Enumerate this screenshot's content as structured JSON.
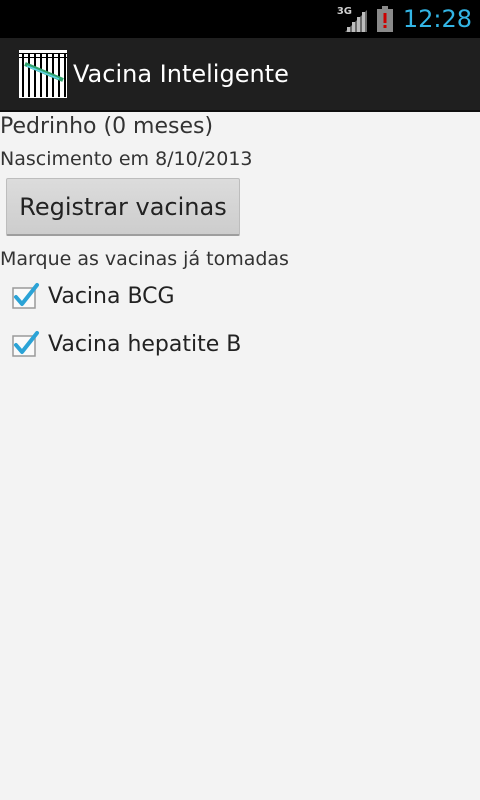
{
  "status_bar": {
    "network_type": "3G",
    "time": "12:28",
    "icons": [
      "signal-icon",
      "battery-alert-icon"
    ]
  },
  "action_bar": {
    "title": "Vacina Inteligente",
    "icon": "app-logo-icon"
  },
  "main": {
    "child_name": "Pedrinho (0 meses)",
    "birth_text": "Nascimento em 8/10/2013",
    "register_button": "Registrar vacinas",
    "instructions": "Marque as vacinas já tomadas",
    "vaccines": [
      {
        "label": "Vacina BCG",
        "checked": true
      },
      {
        "label": "Vacina hepatite B",
        "checked": true
      }
    ]
  },
  "colors": {
    "accent": "#33b5e5",
    "check": "#2ba3d6",
    "battery_alert": "#cc0000"
  }
}
